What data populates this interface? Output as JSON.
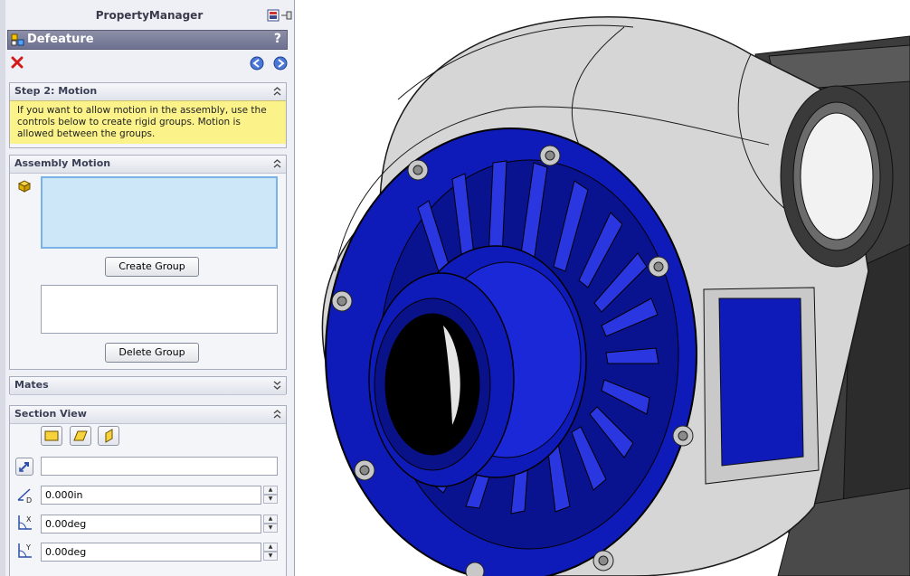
{
  "panel": {
    "title": "PropertyManager",
    "feature_title": "Defeature",
    "help_glyph": "?"
  },
  "motion": {
    "title": "Step 2: Motion",
    "message": "If you want to allow motion in the assembly, use the controls below to create rigid groups. Motion is allowed between the groups."
  },
  "assembly_motion": {
    "title": "Assembly Motion",
    "create_button": "Create Group",
    "delete_button": "Delete Group"
  },
  "mates": {
    "title": "Mates"
  },
  "section_view": {
    "title": "Section View",
    "distance": "0.000in",
    "angle_x": "0.00deg",
    "angle_y": "0.00deg"
  },
  "icons": [
    "properties-icon",
    "pin-icon",
    "defeature-icon",
    "help-icon",
    "cancel-icon",
    "back-icon",
    "forward-icon",
    "collapse-icon",
    "expand-icon",
    "assembly-component-icon",
    "front-plane-icon",
    "top-plane-icon",
    "right-plane-icon",
    "reverse-direction-icon",
    "distance-icon",
    "x-rotation-icon",
    "y-rotation-icon"
  ],
  "colors": {
    "accent_bar": "#6e7190",
    "message_bg": "#fbf38a",
    "selection_box": "#cde6f8",
    "model_blue": "#0f1bb8",
    "model_grey": "#d5d5d5"
  }
}
